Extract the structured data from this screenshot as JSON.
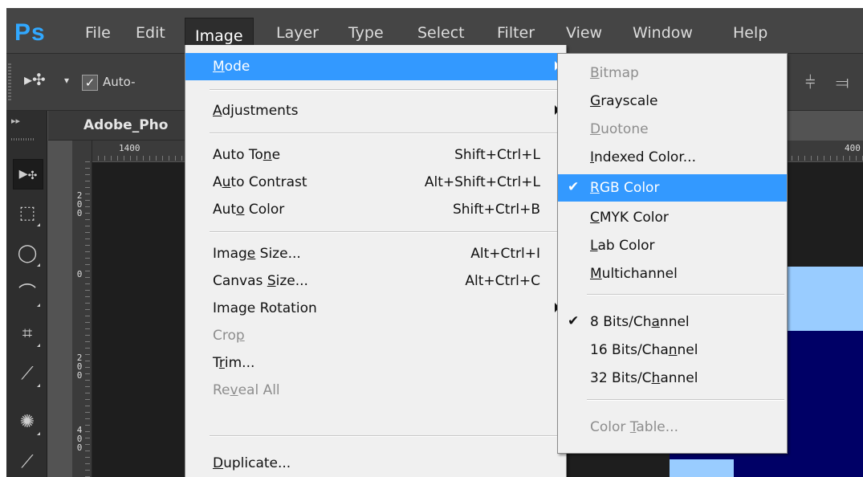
{
  "app": {
    "logo": "Ps"
  },
  "menubar": {
    "items": [
      "File",
      "Edit",
      "Image",
      "Layer",
      "Type",
      "Select",
      "Filter",
      "View",
      "Window",
      "Help"
    ],
    "active": "Image"
  },
  "options_bar": {
    "auto_select_label": "Auto-",
    "auto_select_checked": true
  },
  "document": {
    "tab_title": "Adobe_Pho"
  },
  "rulers": {
    "horizontal_labels": [
      "1400",
      "400"
    ],
    "vertical_labels": [
      "2\n0\n0",
      "0",
      "2\n0\n0",
      "4\n0\n0"
    ]
  },
  "image_menu": {
    "items": [
      {
        "label": "Mode",
        "mnemonic": "M",
        "submenu": true,
        "highlighted": true
      },
      {
        "separator": true
      },
      {
        "label": "Adjustments",
        "mnemonic": "A",
        "submenu": true
      },
      {
        "separator": true
      },
      {
        "label": "Auto Tone",
        "shortcut": "Shift+Ctrl+L"
      },
      {
        "label": "Auto Contrast",
        "shortcut": "Alt+Shift+Ctrl+L"
      },
      {
        "label": "Auto Color",
        "shortcut": "Shift+Ctrl+B"
      },
      {
        "separator": true
      },
      {
        "label": "Image Size...",
        "shortcut": "Alt+Ctrl+I"
      },
      {
        "label": "Canvas Size...",
        "shortcut": "Alt+Ctrl+C"
      },
      {
        "label": "Image Rotation",
        "submenu": true
      },
      {
        "label": "Crop",
        "disabled": true
      },
      {
        "label": "Trim..."
      },
      {
        "label": "Reveal All",
        "disabled": true
      },
      {
        "separator": true
      },
      {
        "label": "Duplicate..."
      }
    ]
  },
  "mode_submenu": {
    "items": [
      {
        "label": "Bitmap",
        "disabled": true
      },
      {
        "label": "Grayscale"
      },
      {
        "label": "Duotone",
        "disabled": true
      },
      {
        "label": "Indexed Color..."
      },
      {
        "label": "RGB Color",
        "checked": true,
        "highlighted": true
      },
      {
        "label": "CMYK Color"
      },
      {
        "label": "Lab Color"
      },
      {
        "label": "Multichannel"
      },
      {
        "separator": true
      },
      {
        "label": "8 Bits/Channel",
        "checked": true
      },
      {
        "label": "16 Bits/Channel"
      },
      {
        "label": "32 Bits/Channel"
      },
      {
        "separator": true
      },
      {
        "label": "Color Table...",
        "disabled": true
      }
    ]
  },
  "colors": {
    "highlight": "#3399ff",
    "canvas_light_blue": "#99ccff",
    "canvas_navy": "#000066"
  },
  "icons": {
    "move_tool": "move-tool-icon",
    "marquee_tool": "rect-marquee-icon",
    "lasso_tool": "lasso-icon",
    "quick_select_tool": "quick-select-icon",
    "crop_tool": "crop-icon",
    "eyedropper_tool": "eyedropper-icon",
    "healing_tool": "spot-healing-icon",
    "brush_tool": "brush-icon"
  }
}
